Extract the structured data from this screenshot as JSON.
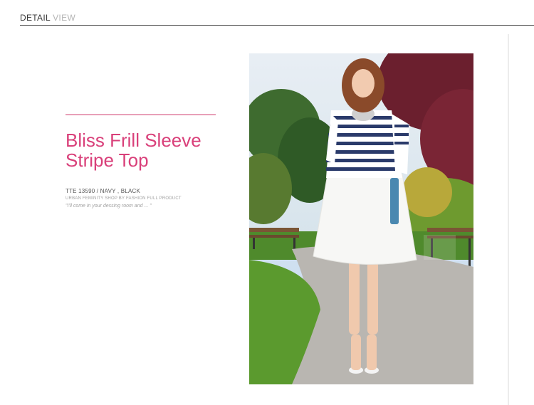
{
  "header": {
    "label_detail": "DETAIL",
    "label_view": "VIEW"
  },
  "product": {
    "title": "Bliss Frill Sleeve Stripe Top",
    "code_line": "TTE 13590 / NAVY , BLACK",
    "tagline": "URBAN FEMINITY SHOP BY  FASHION FULL PRODUCT",
    "quote": "\"I'll come in your dessing room and ... \""
  },
  "colors": {
    "accent_pink": "#d9407a",
    "rule_pink": "#e8a0b8"
  },
  "photo": {
    "description_icon": "model-photo"
  }
}
